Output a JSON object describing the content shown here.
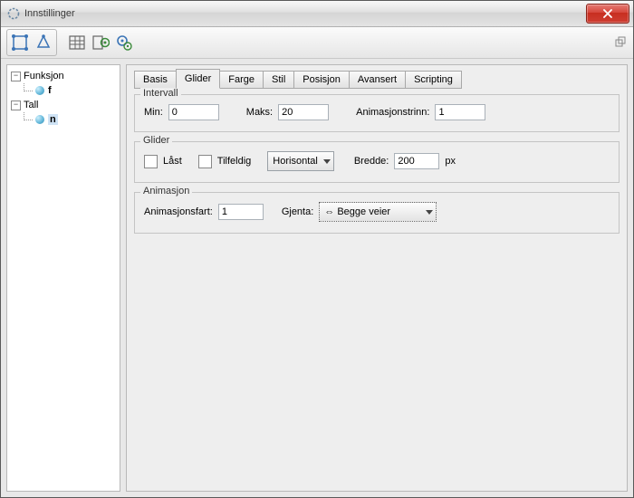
{
  "window": {
    "title": "Innstillinger"
  },
  "tree": {
    "node1": {
      "label": "Funksjon",
      "child": "f"
    },
    "node2": {
      "label": "Tall",
      "child": "n"
    }
  },
  "tabs": {
    "basis": "Basis",
    "glider": "Glider",
    "farge": "Farge",
    "stil": "Stil",
    "posisjon": "Posisjon",
    "avansert": "Avansert",
    "scripting": "Scripting"
  },
  "sections": {
    "intervall": {
      "title": "Intervall",
      "min_label": "Min:",
      "min_value": "0",
      "maks_label": "Maks:",
      "maks_value": "20",
      "trinn_label": "Animasjonstrinn:",
      "trinn_value": "1"
    },
    "glider": {
      "title": "Glider",
      "laast": "Låst",
      "tilfeldig": "Tilfeldig",
      "orientering": "Horisontal",
      "bredde_label": "Bredde:",
      "bredde_value": "200",
      "bredde_unit": "px"
    },
    "animasjon": {
      "title": "Animasjon",
      "fart_label": "Animasjonsfart:",
      "fart_value": "1",
      "gjenta_label": "Gjenta:",
      "gjenta_value": "⇔ Begge veier"
    }
  }
}
